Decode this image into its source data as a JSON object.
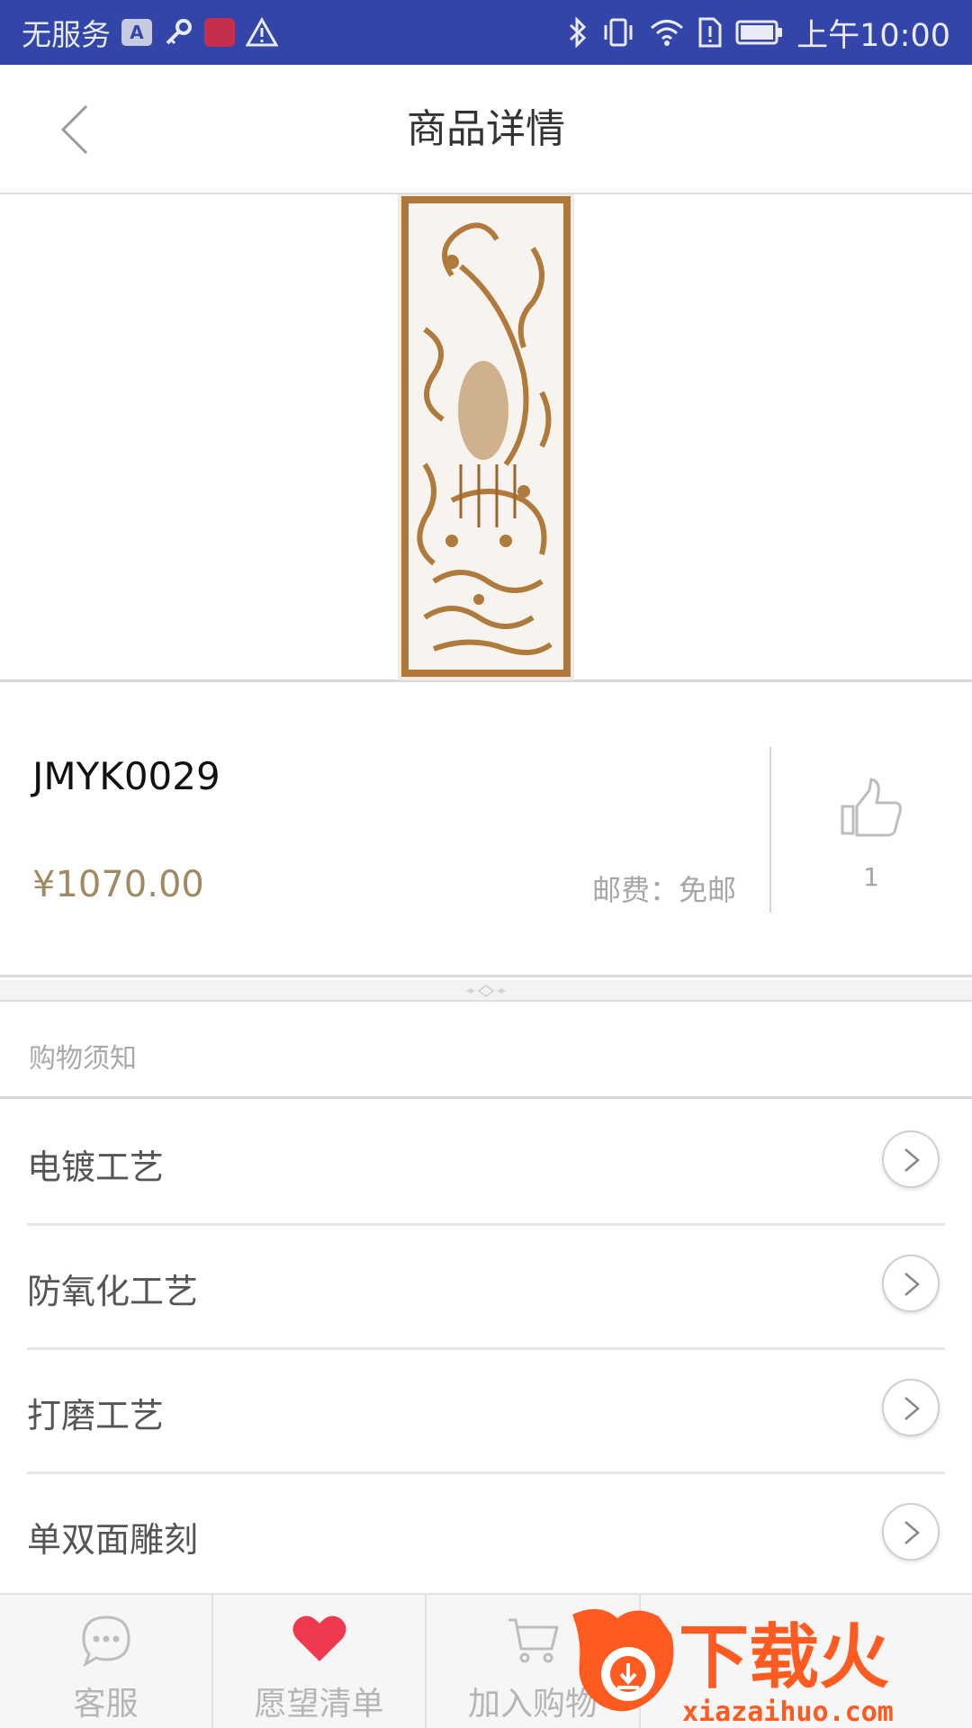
{
  "status_bar": {
    "carrier": "无服务",
    "time": "上午10:00",
    "icons": [
      "a-icon",
      "key-icon",
      "app-icon",
      "warning-icon",
      "bluetooth-icon",
      "vibrate-icon",
      "wifi-icon",
      "sim-alert-icon",
      "battery-icon"
    ]
  },
  "header": {
    "title": "商品详情"
  },
  "product": {
    "sku": "JMYK0029",
    "price": "¥1070.00",
    "shipping": "邮费：免邮",
    "likes": "1"
  },
  "notice": {
    "title": "购物须知"
  },
  "menu": [
    {
      "label": "电镀工艺"
    },
    {
      "label": "防氧化工艺"
    },
    {
      "label": "打磨工艺"
    },
    {
      "label": "单双面雕刻"
    }
  ],
  "tabs": [
    {
      "label": "客服",
      "icon": "chat-icon"
    },
    {
      "label": "愿望清单",
      "icon": "heart-icon"
    },
    {
      "label": "加入购物",
      "icon": "cart-icon"
    }
  ],
  "watermark": {
    "title": "下载火",
    "url": "xiazaihuo.com"
  },
  "colors": {
    "status_bar": "#3345a8",
    "price": "#a08a63",
    "heart": "#f0384e",
    "watermark": "#ff5a1f"
  }
}
